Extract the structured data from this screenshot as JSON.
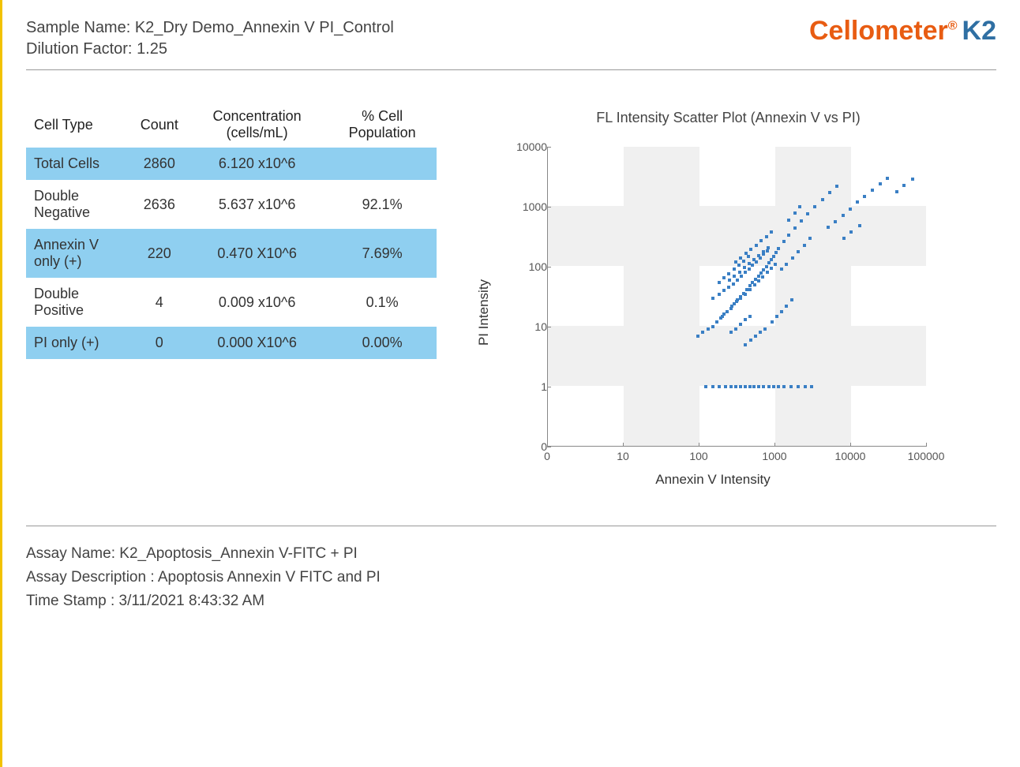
{
  "header": {
    "sample_name_label": "Sample Name: ",
    "sample_name": "K2_Dry Demo_Annexin V PI_Control",
    "dilution_label": "Dilution Factor: ",
    "dilution_factor": "1.25",
    "logo_brand": "Cellometer",
    "logo_reg": "®",
    "logo_model": "K2"
  },
  "table": {
    "headers": [
      "Cell Type",
      "Count",
      "Concentration (cells/mL)",
      "% Cell Population"
    ],
    "rows": [
      {
        "type": "Total Cells",
        "count": "2860",
        "conc": "6.120 x10^6",
        "pop": ""
      },
      {
        "type": "Double Negative",
        "count": "2636",
        "conc": "5.637 x10^6",
        "pop": "92.1%"
      },
      {
        "type": "Annexin V only (+)",
        "count": "220",
        "conc": "0.470 X10^6",
        "pop": "7.69%"
      },
      {
        "type": "Double Positive",
        "count": "4",
        "conc": "0.009 x10^6",
        "pop": "0.1%"
      },
      {
        "type": "PI only (+)",
        "count": "0",
        "conc": "0.000 X10^6",
        "pop": "0.00%"
      }
    ]
  },
  "footer": {
    "assay_name_label": "Assay Name:  ",
    "assay_name": "K2_Apoptosis_Annexin V-FITC + PI",
    "assay_desc_label": "Assay Description  : ",
    "assay_desc": "Apoptosis Annexin V FITC and PI",
    "timestamp_label": "Time Stamp  : ",
    "timestamp": "3/11/2021 8:43:32 AM"
  },
  "chart_data": {
    "type": "scatter",
    "title": "FL Intensity Scatter Plot (Annexin V vs PI)",
    "xlabel": "Annexin V Intensity",
    "ylabel": "PI Intensity",
    "x_scale": "log",
    "y_scale": "log",
    "x_ticks": [
      0,
      10,
      100,
      1000,
      10000,
      100000
    ],
    "y_ticks": [
      0,
      1,
      10,
      100,
      1000,
      10000
    ],
    "xlim": [
      0,
      100000
    ],
    "ylim": [
      0,
      10000
    ],
    "note": "Dense cluster roughly Annexin V 100–1000, PI 10–200; sparse upper-right points; horizontal line of points at PI≈1 from Annexin V≈200–3000.",
    "points_sample": [
      [
        120,
        1
      ],
      [
        150,
        1
      ],
      [
        180,
        1
      ],
      [
        220,
        1
      ],
      [
        260,
        1
      ],
      [
        300,
        1
      ],
      [
        350,
        1
      ],
      [
        400,
        1
      ],
      [
        460,
        1
      ],
      [
        520,
        1
      ],
      [
        600,
        1
      ],
      [
        700,
        1
      ],
      [
        820,
        1
      ],
      [
        950,
        1
      ],
      [
        1100,
        1
      ],
      [
        1300,
        1
      ],
      [
        1600,
        1
      ],
      [
        2000,
        1
      ],
      [
        2500,
        1
      ],
      [
        3000,
        1
      ],
      [
        95,
        7
      ],
      [
        110,
        8
      ],
      [
        130,
        9
      ],
      [
        150,
        10
      ],
      [
        170,
        12
      ],
      [
        190,
        14
      ],
      [
        210,
        16
      ],
      [
        230,
        18
      ],
      [
        260,
        20
      ],
      [
        290,
        24
      ],
      [
        320,
        28
      ],
      [
        350,
        32
      ],
      [
        380,
        36
      ],
      [
        420,
        42
      ],
      [
        460,
        48
      ],
      [
        500,
        55
      ],
      [
        550,
        62
      ],
      [
        600,
        70
      ],
      [
        650,
        78
      ],
      [
        700,
        88
      ],
      [
        760,
        100
      ],
      [
        820,
        115
      ],
      [
        880,
        130
      ],
      [
        950,
        150
      ],
      [
        1020,
        170
      ],
      [
        150,
        30
      ],
      [
        180,
        35
      ],
      [
        210,
        40
      ],
      [
        240,
        46
      ],
      [
        280,
        52
      ],
      [
        320,
        60
      ],
      [
        360,
        70
      ],
      [
        400,
        80
      ],
      [
        450,
        92
      ],
      [
        500,
        105
      ],
      [
        560,
        120
      ],
      [
        630,
        140
      ],
      [
        700,
        160
      ],
      [
        780,
        185
      ],
      [
        200,
        15
      ],
      [
        230,
        18
      ],
      [
        270,
        22
      ],
      [
        310,
        26
      ],
      [
        350,
        30
      ],
      [
        400,
        35
      ],
      [
        460,
        42
      ],
      [
        530,
        50
      ],
      [
        600,
        58
      ],
      [
        680,
        68
      ],
      [
        780,
        80
      ],
      [
        880,
        95
      ],
      [
        1000,
        110
      ],
      [
        250,
        60
      ],
      [
        290,
        70
      ],
      [
        340,
        82
      ],
      [
        390,
        96
      ],
      [
        450,
        112
      ],
      [
        520,
        130
      ],
      [
        600,
        152
      ],
      [
        690,
        178
      ],
      [
        800,
        210
      ],
      [
        300,
        120
      ],
      [
        350,
        140
      ],
      [
        410,
        165
      ],
      [
        480,
        195
      ],
      [
        560,
        230
      ],
      [
        650,
        270
      ],
      [
        760,
        318
      ],
      [
        880,
        375
      ],
      [
        1100,
        200
      ],
      [
        1300,
        260
      ],
      [
        1500,
        340
      ],
      [
        1800,
        440
      ],
      [
        2200,
        580
      ],
      [
        2700,
        770
      ],
      [
        3300,
        1000
      ],
      [
        4200,
        1300
      ],
      [
        5200,
        1700
      ],
      [
        6500,
        2200
      ],
      [
        1200,
        90
      ],
      [
        1400,
        110
      ],
      [
        1700,
        140
      ],
      [
        2000,
        180
      ],
      [
        2400,
        230
      ],
      [
        2900,
        300
      ],
      [
        900,
        12
      ],
      [
        1050,
        15
      ],
      [
        1200,
        18
      ],
      [
        1400,
        22
      ],
      [
        1650,
        28
      ],
      [
        5000,
        450
      ],
      [
        6200,
        560
      ],
      [
        7800,
        720
      ],
      [
        9800,
        920
      ],
      [
        12000,
        1200
      ],
      [
        15000,
        1500
      ],
      [
        19000,
        1900
      ],
      [
        24000,
        2400
      ],
      [
        30000,
        3000
      ],
      [
        40000,
        1800
      ],
      [
        50000,
        2300
      ],
      [
        65000,
        2900
      ],
      [
        8000,
        300
      ],
      [
        10000,
        380
      ],
      [
        13000,
        490
      ],
      [
        1500,
        600
      ],
      [
        1800,
        780
      ],
      [
        2100,
        1000
      ],
      [
        400,
        5
      ],
      [
        470,
        6
      ],
      [
        550,
        7
      ],
      [
        640,
        8
      ],
      [
        740,
        9
      ],
      [
        180,
        55
      ],
      [
        210,
        65
      ],
      [
        245,
        76
      ],
      [
        285,
        90
      ],
      [
        330,
        105
      ],
      [
        385,
        125
      ],
      [
        445,
        148
      ],
      [
        260,
        8
      ],
      [
        300,
        9
      ],
      [
        345,
        11
      ],
      [
        400,
        13
      ],
      [
        460,
        15
      ]
    ]
  }
}
